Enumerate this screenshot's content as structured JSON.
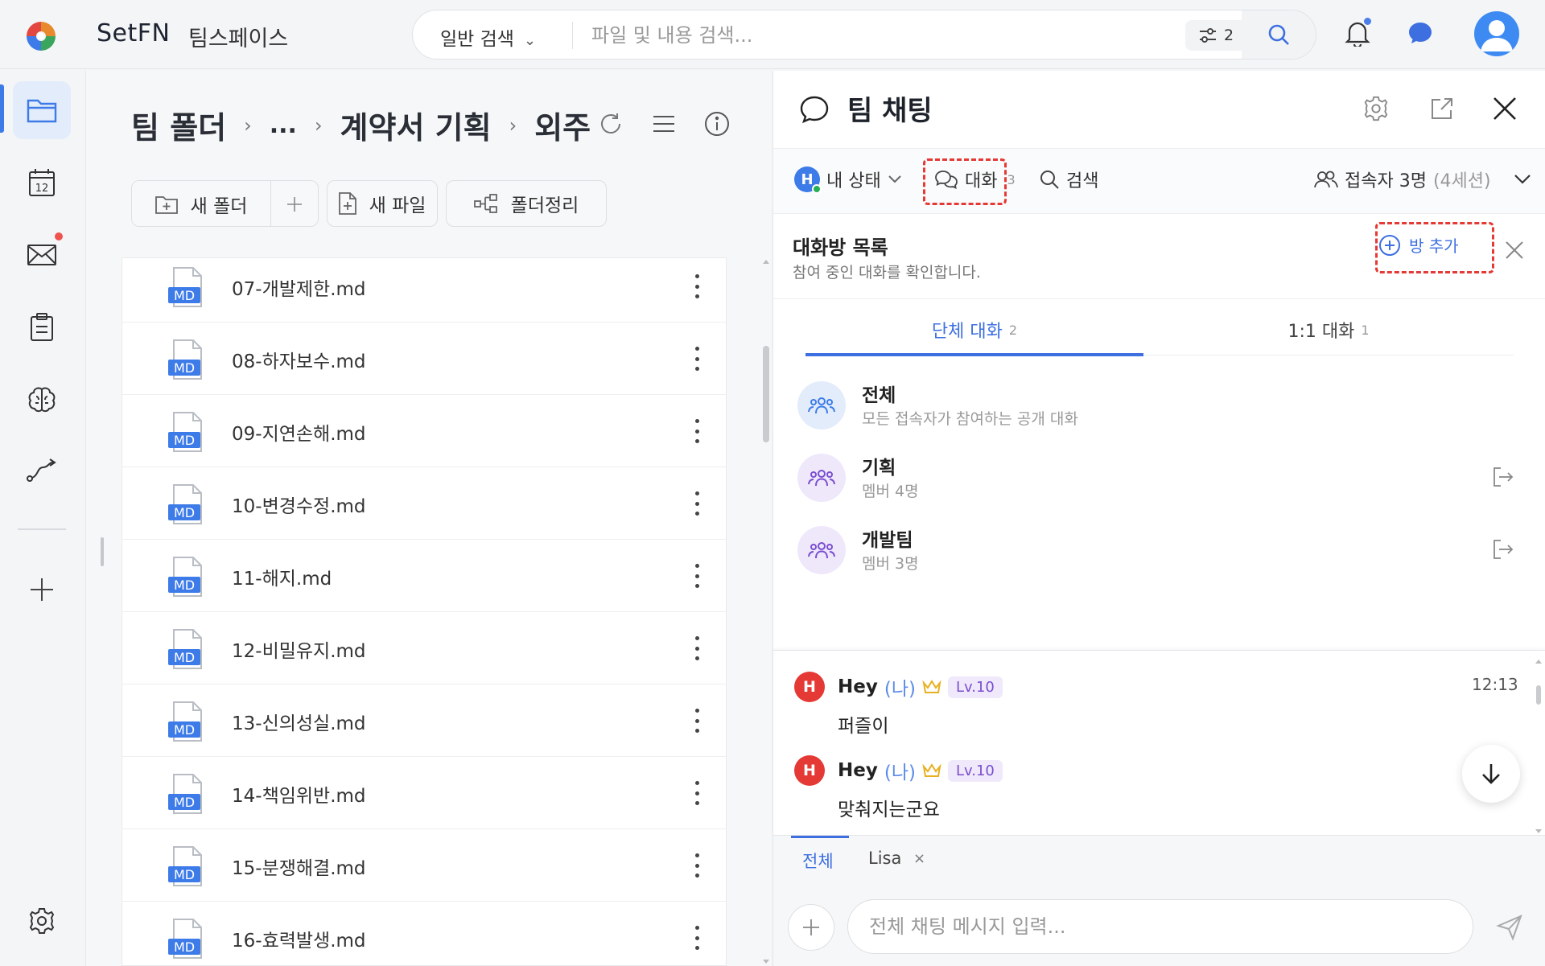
{
  "app": {
    "brand": "SetFN",
    "workspace": "팀스페이스"
  },
  "search": {
    "scope": "일반 검색",
    "placeholder": "파일 및 내용 검색...",
    "filter_count": "2"
  },
  "folder": {
    "breadcrumb": [
      "팀 폴더",
      "...",
      "계약서 기획",
      "외주"
    ],
    "toolbar": {
      "new_folder": "새 폴더",
      "new_file": "새 파일",
      "organize": "폴더정리"
    },
    "files": [
      {
        "badge": "MD",
        "name": "07-개발제한.md"
      },
      {
        "badge": "MD",
        "name": "08-하자보수.md"
      },
      {
        "badge": "MD",
        "name": "09-지연손해.md"
      },
      {
        "badge": "MD",
        "name": "10-변경수정.md"
      },
      {
        "badge": "MD",
        "name": "11-해지.md"
      },
      {
        "badge": "MD",
        "name": "12-비밀유지.md"
      },
      {
        "badge": "MD",
        "name": "13-신의성실.md"
      },
      {
        "badge": "MD",
        "name": "14-책임위반.md"
      },
      {
        "badge": "MD",
        "name": "15-분쟁해결.md"
      },
      {
        "badge": "MD",
        "name": "16-효력발생.md"
      }
    ]
  },
  "rail": {
    "calendar_day": "12"
  },
  "chat": {
    "title": "팀 채팅",
    "my_status": "내 상태",
    "my_initial": "H",
    "conversations_label": "대화",
    "conversations_count": "3",
    "search_label": "검색",
    "participants_label": "접속자 3명",
    "participants_sessions": "(4세션)",
    "room_list": {
      "title": "대화방 목록",
      "subtitle": "참여 중인 대화를 확인합니다.",
      "add_label": "방 추가"
    },
    "tabs": [
      {
        "label": "단체 대화",
        "count": "2"
      },
      {
        "label": "1:1 대화",
        "count": "1"
      }
    ],
    "rooms": [
      {
        "name": "전체",
        "sub": "모든 접속자가 참여하는 공개 대화"
      },
      {
        "name": "기획",
        "sub": "멤버 4명"
      },
      {
        "name": "개발팀",
        "sub": "멤버 3명"
      }
    ],
    "messages": [
      {
        "initial": "H",
        "author": "Hey",
        "me": "(나)",
        "level": "Lv.10",
        "time": "12:13",
        "text": "퍼즐이"
      },
      {
        "initial": "H",
        "author": "Hey",
        "me": "(나)",
        "level": "Lv.10",
        "time": "",
        "text": "맞춰지는군요"
      }
    ],
    "chat_tabs": {
      "all": "전체",
      "lisa": "Lisa",
      "close": "×"
    },
    "compose_placeholder": "전체 채팅 메시지 입력..."
  },
  "colors": {
    "accent": "#3d6fe0",
    "highlight_dash": "#e53935",
    "md_badge": "#3d7be8",
    "online": "#26b054"
  }
}
